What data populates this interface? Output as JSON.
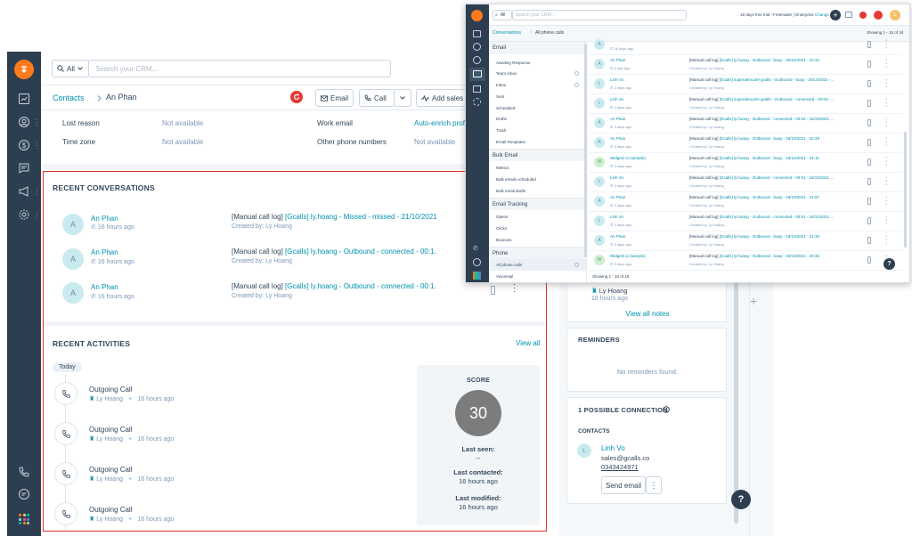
{
  "main": {
    "search": {
      "scope": "All",
      "placeholder": "Search your CRM..."
    },
    "breadcrumb": {
      "root": "Contacts",
      "current": "An Phan"
    },
    "header_buttons": {
      "email": "Email",
      "call": "Call",
      "add_sales": "Add sales activity"
    },
    "fields": [
      {
        "label": "Lost reason",
        "value": "Not available"
      },
      {
        "label": "Time zone",
        "value": "Not available"
      },
      {
        "label": "Work email",
        "value": "Auto-enrich profile"
      },
      {
        "label": "Other phone numbers",
        "value": "Not available"
      }
    ],
    "recent_conversations": {
      "title": "RECENT CONVERSATIONS",
      "items": [
        {
          "name": "An Phan",
          "avatar": "A",
          "time": "16 hours ago",
          "title_prefix": "[Manual call log] ",
          "title_link": "[Gcalls] ly.hoang - Missed - missed - 21/10/2021 ...",
          "created": "Created by: Ly Hoang"
        },
        {
          "name": "An Phan",
          "avatar": "A",
          "time": "16 hours ago",
          "title_prefix": "[Manual call log] ",
          "title_link": "[Gcalls] ly.hoang - Outbound - connected - 00:1...",
          "created": "Created by: Ly Hoang"
        },
        {
          "name": "An Phan",
          "avatar": "A",
          "time": "16 hours ago",
          "title_prefix": "[Manual call log] ",
          "title_link": "[Gcalls] ly.hoang - Outbound - connected - 00:1...",
          "created": "Created by: Ly Hoang"
        }
      ]
    },
    "recent_activities": {
      "title": "RECENT ACTIVITIES",
      "view_all": "View all",
      "today": "Today",
      "items": [
        {
          "title": "Outgoing Call",
          "owner": "Ly Hoang",
          "time": "16 hours ago"
        },
        {
          "title": "Outgoing Call",
          "owner": "Ly Hoang",
          "time": "16 hours ago"
        },
        {
          "title": "Outgoing Call",
          "owner": "Ly Hoang",
          "time": "16 hours ago"
        },
        {
          "title": "Outgoing Call",
          "owner": "Ly Hoang",
          "time": "16 hours ago"
        }
      ]
    },
    "score_card": {
      "title": "SCORE",
      "score": "30",
      "last_seen_label": "Last seen:",
      "last_seen": "--",
      "last_contacted_label": "Last contacted:",
      "last_contacted": "16 hours ago",
      "last_modified_label": "Last modified:",
      "last_modified": "16 hours ago"
    },
    "right": {
      "note_owner": "Ly Hoang",
      "note_time": "16 hours ago",
      "view_all_notes": "View all notes",
      "reminders_title": "REMINDERS",
      "reminders_empty": "No reminders found.",
      "connections_title": "1 POSSIBLE CONNECTION",
      "contacts_label": "CONTACTS",
      "contact": {
        "avatar": "L",
        "name": "Linh Vo",
        "email": "sales@gcalls.co",
        "phone": "0343424971"
      },
      "send_email": "Send email",
      "help": "?",
      "plus": "+"
    }
  },
  "overlay": {
    "search": {
      "scope": "All",
      "placeholder": "Search your CRM..."
    },
    "trial": "18 days free trial : Freemailer | Enterprise",
    "change": "Change",
    "breadcrumb": {
      "root": "Conversations",
      "current": "All phone calls"
    },
    "showing_top": "Showing 1 - 18 of 18",
    "showing_bottom": "Showing 1 - 18 of 18",
    "sidebar": {
      "email_title": "Email",
      "email_items": [
        "Awaiting Response",
        "Team Inbox",
        "Inbox",
        "Sent",
        "Scheduled",
        "Drafts",
        "Trash",
        "Email Templates"
      ],
      "bulk_title": "Bulk Email",
      "bulk_items": [
        "Metrics",
        "Bulk emails scheduled",
        "Bulk email drafts"
      ],
      "tracking_title": "Email Tracking",
      "tracking_items": [
        "Opens",
        "Clicks",
        "Bounces"
      ],
      "phone_title": "Phone",
      "phone_items": [
        "All phone calls",
        "Voicemail"
      ]
    },
    "rows": [
      {
        "avatar": "A",
        "name": "",
        "time": "16 days ago",
        "title": "",
        "link": "",
        "created": "",
        "green": false
      },
      {
        "avatar": "A",
        "name": "An Phan",
        "time": "a day ago",
        "title": "[Manual call log] ",
        "link": "[Gcalls] ly.hoang - Outbound - buay - 20/10/2021 - 22:42",
        "created": "Created by: Ly Hoang",
        "green": false
      },
      {
        "avatar": "L",
        "name": "Linh Vo",
        "time": "3 days ago",
        "title": "[Manual call log] ",
        "link": "[Gcalls] superdemo25+gcalls - Outbound - buay - 20/10/2021 -...",
        "created": "Created by: Ly Hoang",
        "green": false
      },
      {
        "avatar": "L",
        "name": "Linh Vo",
        "time": "3 days ago",
        "title": "[Manual call log] ",
        "link": "[Gcalls] superdemo25+gcalls - Outbound - connected - 00:03 -...",
        "created": "Created by: Ly Hoang",
        "green": false
      },
      {
        "avatar": "A",
        "name": "An Phan",
        "time": "3 days ago",
        "title": "[Manual call log] ",
        "link": "[Gcalls] ly.hoang - Outbound - connected - 00:02 - 18/10/2021 ...",
        "created": "Created by: Ly Hoang",
        "green": false
      },
      {
        "avatar": "A",
        "name": "An Phan",
        "time": "3 days ago",
        "title": "[Manual call log] ",
        "link": "[Gcalls] ly.hoang - Outbound - buay - 18/10/2021 - 22:49",
        "created": "Created by: Ly Hoang",
        "green": false
      },
      {
        "avatar": "W",
        "name": "Widgetz.io (sample)",
        "time": "3 days ago",
        "title": "[Manual call log] ",
        "link": "[Gcalls] ly.hoang - Outbound - buay - 18/10/2021 - 21:11",
        "created": "Created by: Ly Hoang",
        "green": true
      },
      {
        "avatar": "L",
        "name": "Linh Vo",
        "time": "3 days ago",
        "title": "[Manual call log] ",
        "link": "[Gcalls] ly.hoang - Outbound - connected - 00:01 - 18/10/2021 ...",
        "created": "Created by: Ly Hoang",
        "green": false
      },
      {
        "avatar": "A",
        "name": "An Phan",
        "time": "3 days ago",
        "title": "[Manual call log] ",
        "link": "[Gcalls] ly.hoang - Outbound - buay - 18/10/2021 - 21:57",
        "created": "Created by: Ly Hoang",
        "green": false
      },
      {
        "avatar": "L",
        "name": "Linh Vo",
        "time": "3 days ago",
        "title": "[Manual call log] ",
        "link": "[Gcalls] ly.hoang - Outbound - connected - 00:01 - 18/10/2021 ...",
        "created": "Created by: Ly Hoang",
        "green": false
      },
      {
        "avatar": "A",
        "name": "An Phan",
        "time": "3 days ago",
        "title": "[Manual call log] ",
        "link": "[Gcalls] ly.hoang - Outbound - buay - 18/10/2021 - 21:30",
        "created": "Created by: Ly Hoang",
        "green": false
      },
      {
        "avatar": "W",
        "name": "Widgetz.io (sample)",
        "time": "3 days ago",
        "title": "[Manual call log] ",
        "link": "[Gcalls] ly.hoang - Outbound - buay - 18/10/2021 - 20:35",
        "created": "Created by: Ly Hoang",
        "green": true
      }
    ]
  },
  "colors": {
    "nav": "#2d3e50",
    "accent": "#ff7a1a",
    "link": "#0091ae",
    "highlight": "#e03030"
  }
}
